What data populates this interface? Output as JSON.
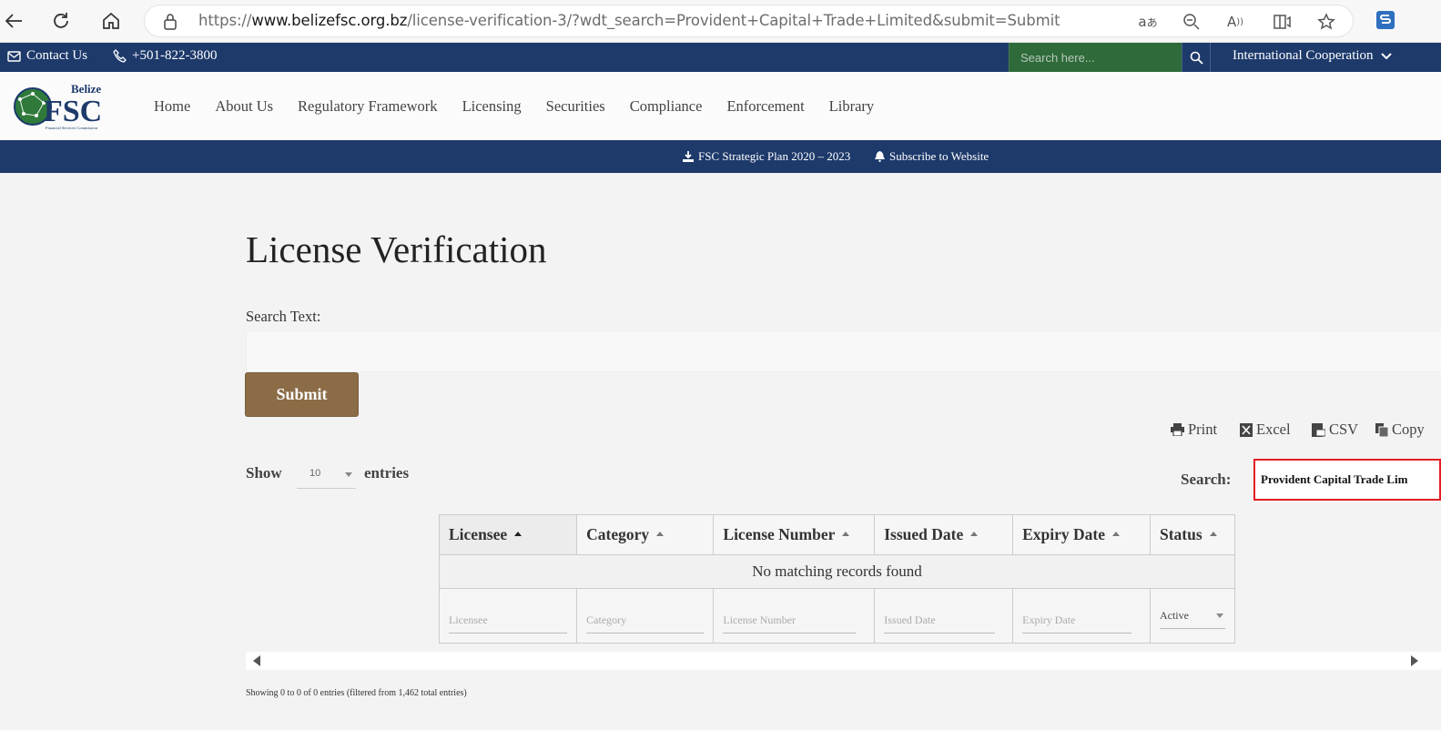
{
  "browser": {
    "url_prefix": "https://",
    "url_host": "www.belizefsc.org.bz",
    "url_path": "/license-verification-3/?wdt_search=Provident+Capital+Trade+Limited&submit=Submit",
    "icons": [
      "back-icon",
      "refresh-icon",
      "home-icon",
      "lock-icon",
      "translate-icon",
      "zoom-icon",
      "read-aloud-icon",
      "immersive-reader-icon",
      "favorite-icon",
      "extension-icon"
    ]
  },
  "topbar": {
    "contact": "Contact Us",
    "phone": "+501-822-3800",
    "search_placeholder": "Search here...",
    "intl": "International Cooperation"
  },
  "logo": {
    "word1": "Belize",
    "word2": "FSC",
    "tagline": "Financial Services Commission"
  },
  "nav": {
    "items": [
      "Home",
      "About Us",
      "Regulatory Framework",
      "Licensing",
      "Securities",
      "Compliance",
      "Enforcement",
      "Library"
    ]
  },
  "subbar": {
    "plan": "FSC Strategic Plan 2020 – 2023",
    "subscribe": "Subscribe to Website"
  },
  "page": {
    "title": "License Verification",
    "search_label": "Search Text:",
    "search_value": "",
    "submit": "Submit"
  },
  "export": {
    "print": "Print",
    "excel": "Excel",
    "csv": "CSV",
    "copy": "Copy"
  },
  "table_controls": {
    "show": "Show",
    "page_size": "10",
    "entries": "entries",
    "search_label": "Search:",
    "search_value": "Provident Capital Trade Lim"
  },
  "table": {
    "columns": [
      "Licensee",
      "Category",
      "License Number",
      "Issued Date",
      "Expiry Date",
      "Status"
    ],
    "empty_message": "No matching records found",
    "filters": [
      "Licensee",
      "Category",
      "License Number",
      "Issued Date",
      "Expiry Date"
    ],
    "status_filter": "Active"
  },
  "info": "Showing 0 to 0 of 0 entries (filtered from 1,462 total entries)",
  "colors": {
    "navy": "#1d3a6b",
    "green": "#2e6a3a",
    "submit": "#8b6c47",
    "highlight": "#e31e24"
  }
}
